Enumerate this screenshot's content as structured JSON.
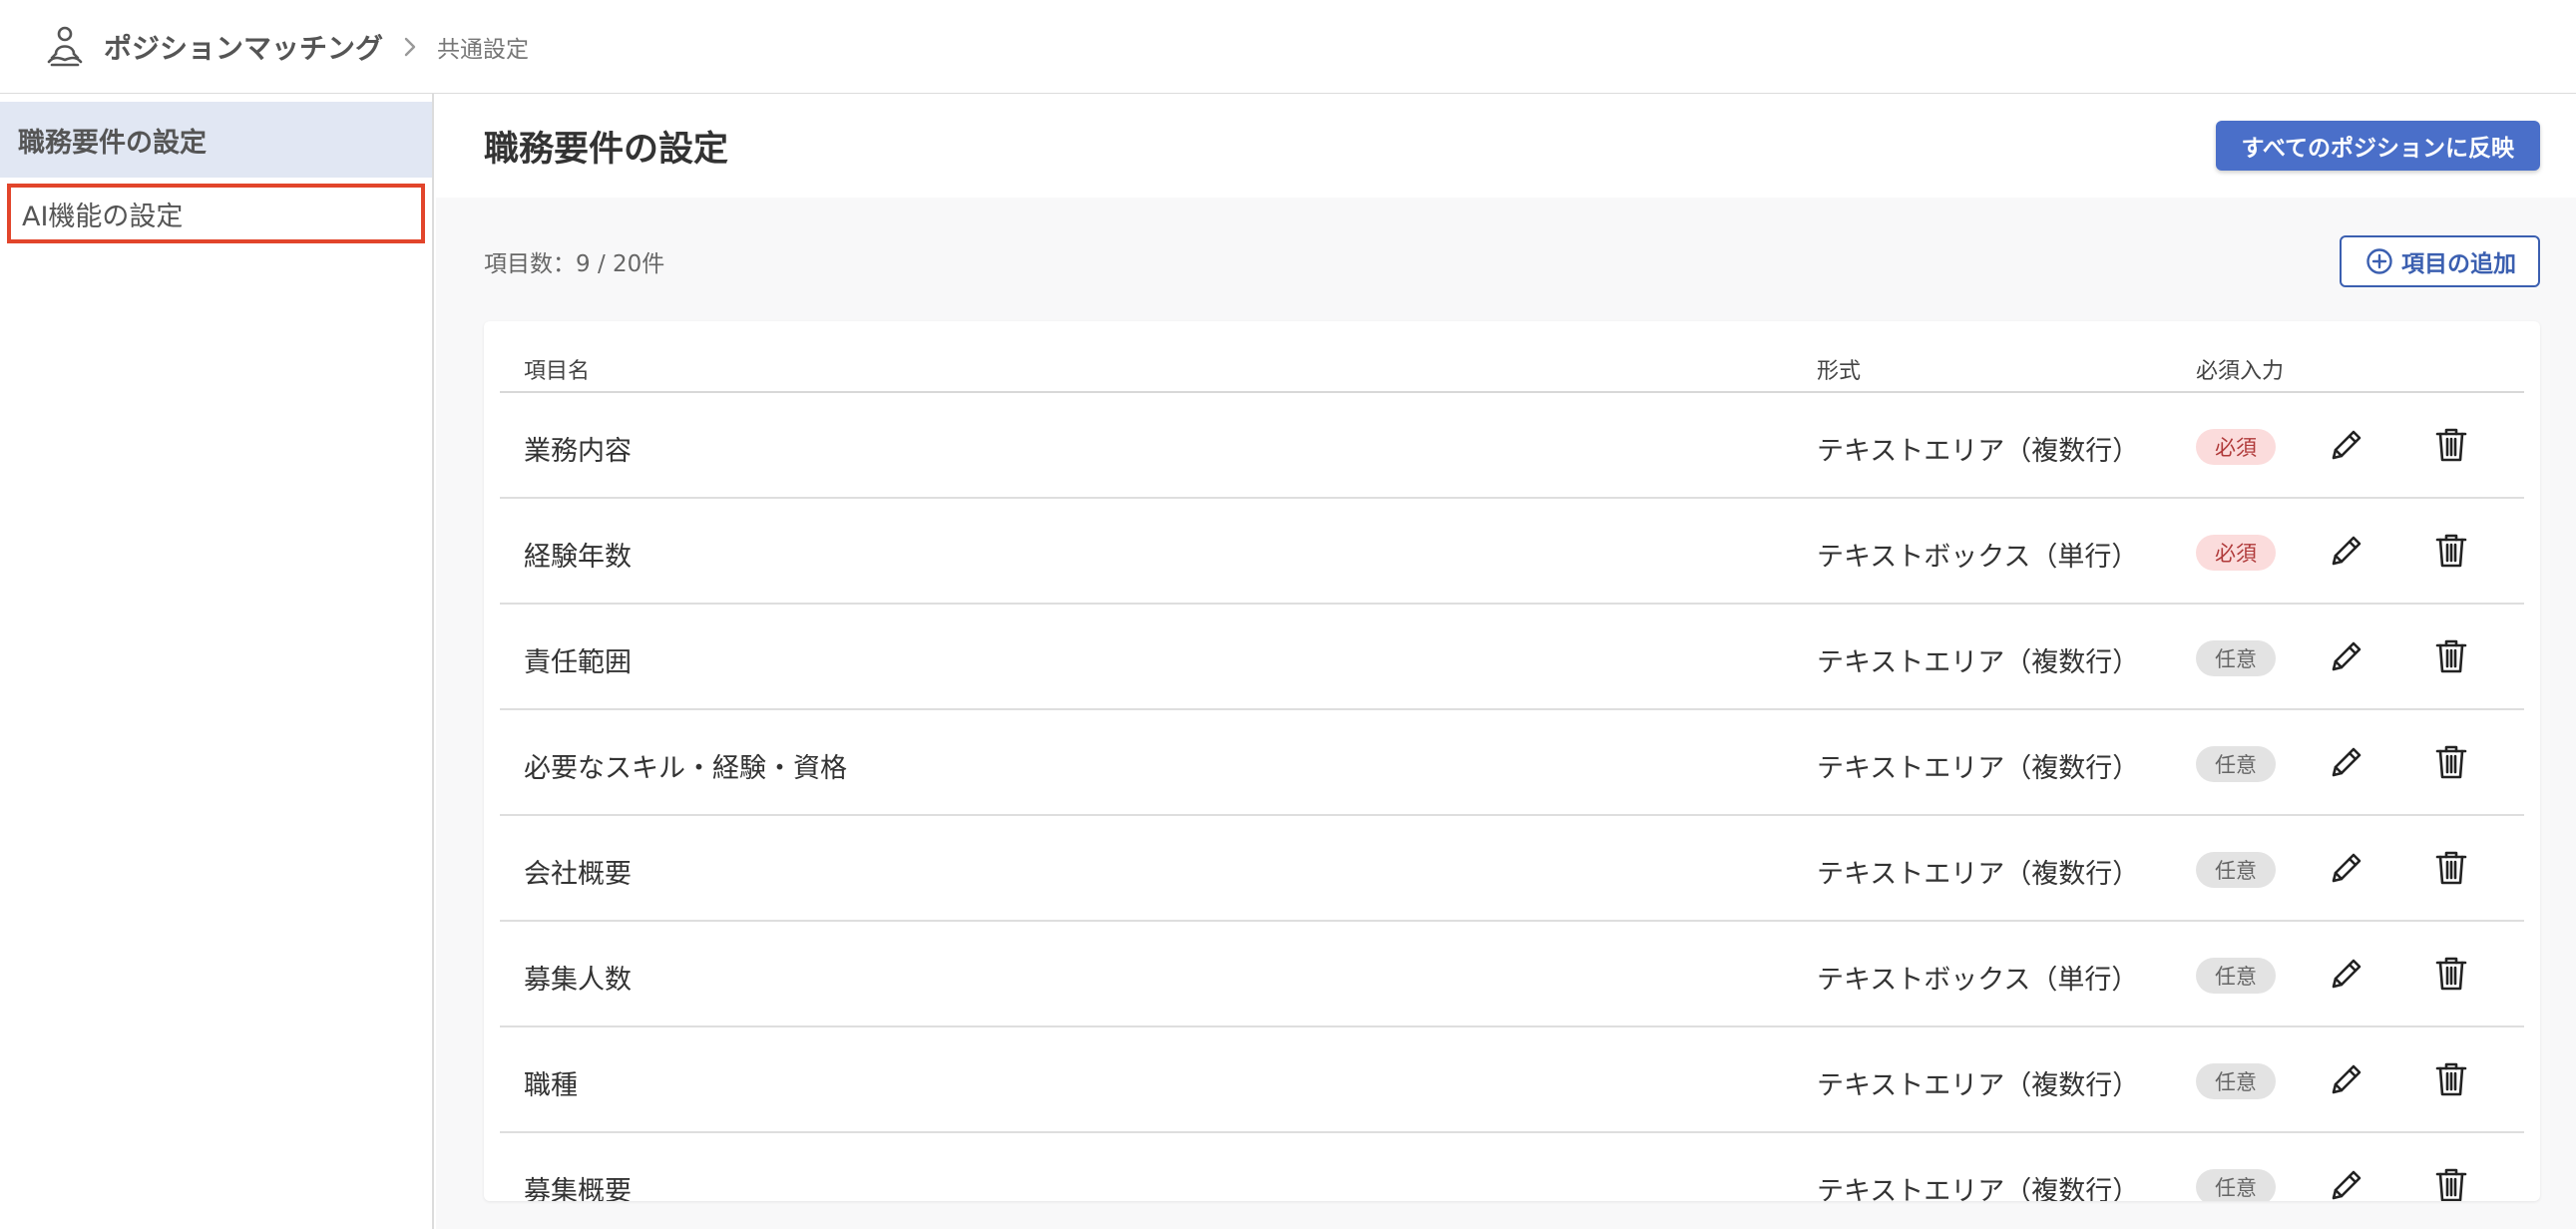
{
  "header": {
    "app_title": "ポジションマッチング",
    "breadcrumb": "共通設定"
  },
  "sidebar": {
    "items": [
      {
        "label": "職務要件の設定"
      },
      {
        "label": "AI機能の設定"
      }
    ]
  },
  "main": {
    "title": "職務要件の設定",
    "apply_button": "すべてのポジションに反映",
    "count_label": "項目数：9 / 20件",
    "add_button": "項目の追加"
  },
  "table": {
    "columns": {
      "name": "項目名",
      "type": "形式",
      "required": "必須入力"
    },
    "rows": [
      {
        "name": "業務内容",
        "type": "テキストエリア（複数行）",
        "badge": "必須",
        "badge_kind": "req"
      },
      {
        "name": "経験年数",
        "type": "テキストボックス（単行）",
        "badge": "必須",
        "badge_kind": "req"
      },
      {
        "name": "責任範囲",
        "type": "テキストエリア（複数行）",
        "badge": "任意",
        "badge_kind": "opt"
      },
      {
        "name": "必要なスキル・経験・資格",
        "type": "テキストエリア（複数行）",
        "badge": "任意",
        "badge_kind": "opt"
      },
      {
        "name": "会社概要",
        "type": "テキストエリア（複数行）",
        "badge": "任意",
        "badge_kind": "opt"
      },
      {
        "name": "募集人数",
        "type": "テキストボックス（単行）",
        "badge": "任意",
        "badge_kind": "opt"
      },
      {
        "name": "職種",
        "type": "テキストエリア（複数行）",
        "badge": "任意",
        "badge_kind": "opt"
      },
      {
        "name": "募集概要",
        "type": "テキストエリア（複数行）",
        "badge": "任意",
        "badge_kind": "opt"
      }
    ]
  },
  "colors": {
    "primary": "#4a6fc9",
    "highlight": "#e2452b",
    "required_bg": "#fbdcdc",
    "optional_bg": "#e3e3e3"
  }
}
